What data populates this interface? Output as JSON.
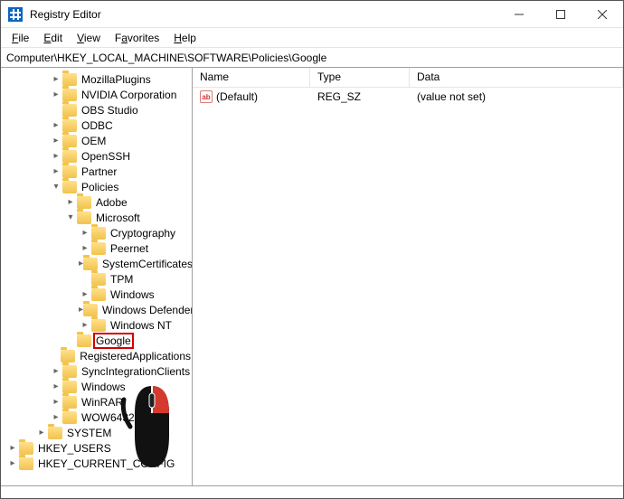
{
  "window": {
    "title": "Registry Editor"
  },
  "menu": {
    "file": "File",
    "edit": "Edit",
    "view": "View",
    "favorites": "Favorites",
    "help": "Help"
  },
  "address": {
    "path": "Computer\\HKEY_LOCAL_MACHINE\\SOFTWARE\\Policies\\Google"
  },
  "tree": {
    "n0": "MozillaPlugins",
    "n1": "NVIDIA Corporation",
    "n2": "OBS Studio",
    "n3": "ODBC",
    "n4": "OEM",
    "n5": "OpenSSH",
    "n6": "Partner",
    "n7": "Policies",
    "n8": "Adobe",
    "n9": "Microsoft",
    "n10": "Cryptography",
    "n11": "Peernet",
    "n12": "SystemCertificates",
    "n13": "TPM",
    "n14": "Windows",
    "n15": "Windows Defender",
    "n16": "Windows NT",
    "n17": "Google",
    "n18": "RegisteredApplications",
    "n19": "SyncIntegrationClients",
    "n20": "Windows",
    "n21": "WinRAR",
    "n22": "WOW6432Node",
    "n23": "SYSTEM",
    "n24": "HKEY_USERS",
    "n25": "HKEY_CURRENT_CONFIG"
  },
  "list": {
    "headers": {
      "name": "Name",
      "type": "Type",
      "data": "Data"
    },
    "row0": {
      "name": "(Default)",
      "type": "REG_SZ",
      "data": "(value not set)",
      "icon": "ab"
    }
  }
}
